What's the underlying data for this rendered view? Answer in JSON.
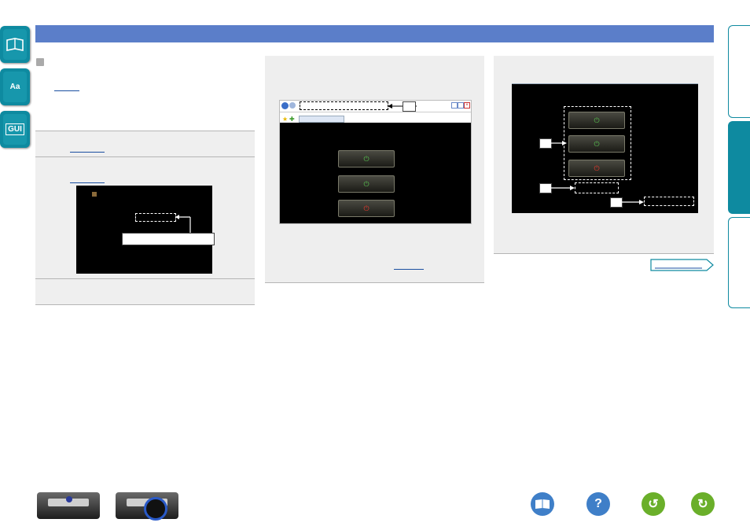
{
  "left_tabs": [
    {
      "name": "contents-icon",
      "label": "",
      "color": "#0e8aa0"
    },
    {
      "name": "index-icon",
      "label": "Aa",
      "color": "#0e8aa0"
    },
    {
      "name": "gui-icon",
      "label": "GUI",
      "color": "#0e8aa0"
    }
  ],
  "header": {
    "color": "#5b7ec9",
    "title": ""
  },
  "colors": {
    "accent": "#0e8aa0",
    "screen": "#000000",
    "power_on": "#57c04f",
    "power_off": "#e23a2e",
    "link": "#1a4fa0"
  },
  "col1": {
    "note_icon": "pencil-icon",
    "dialog_label": "",
    "power_symbols": [
      "⏻"
    ]
  },
  "col2": {
    "browser_icons": [
      "back-icon",
      "forward-icon",
      "favorites-icon",
      "add-favorite-icon"
    ]
  },
  "col3": {},
  "footer": {
    "buttons": [
      "book-icon",
      "help-icon",
      "back-icon",
      "forward-icon"
    ],
    "glyphs": {
      "help": "?",
      "back": "↺",
      "forward": "↻"
    }
  },
  "next_arrow": "next-page-arrow-icon"
}
